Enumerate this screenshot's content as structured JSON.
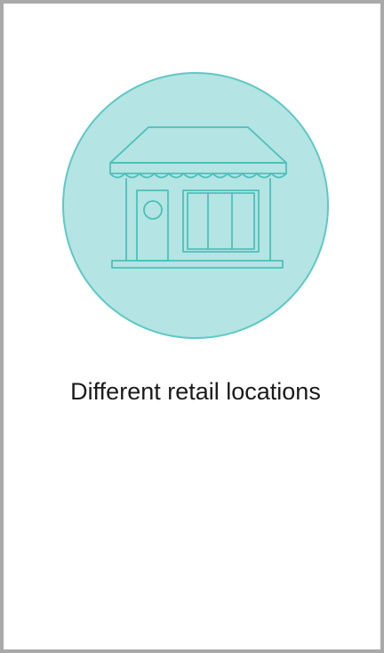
{
  "card": {
    "icon": "storefront-icon",
    "caption": "Different retail locations"
  },
  "colors": {
    "circle_fill": "#b4e4e3",
    "circle_stroke": "#5ec9c5",
    "icon_line": "#4cc0bb",
    "text": "#1a1a1a",
    "border": "#a9a9a9"
  }
}
